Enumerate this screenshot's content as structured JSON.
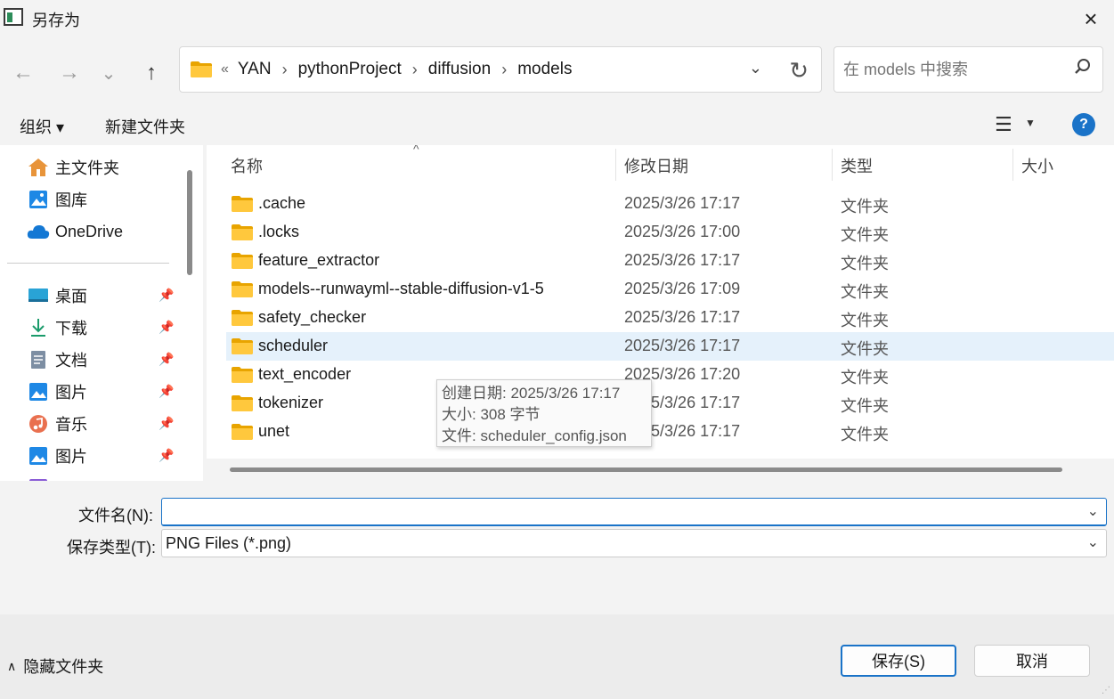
{
  "window": {
    "title": "另存为",
    "close_icon": "×"
  },
  "nav": {
    "back_icon": "←",
    "forward_icon": "→",
    "recent_icon": "⌄",
    "up_icon": "↑",
    "crumbs_lead": "«",
    "crumbs": [
      "YAN",
      "pythonProject",
      "diffusion",
      "models"
    ],
    "dropdown_icon": "⌄",
    "refresh_icon": "↻",
    "search_placeholder": "在 models 中搜索"
  },
  "toolbar": {
    "organize": "组织 ▾",
    "new_folder": "新建文件夹",
    "help": "?"
  },
  "sidebar": {
    "top": [
      {
        "label": "主文件夹",
        "icon": "home-icon"
      },
      {
        "label": "图库",
        "icon": "gallery-icon"
      },
      {
        "label": "OneDrive",
        "icon": "cloud-icon"
      }
    ],
    "pinned": [
      {
        "label": "桌面",
        "icon": "desktop-icon"
      },
      {
        "label": "下载",
        "icon": "download-icon"
      },
      {
        "label": "文档",
        "icon": "document-icon"
      },
      {
        "label": "图片",
        "icon": "pictures-icon"
      },
      {
        "label": "音乐",
        "icon": "music-icon"
      },
      {
        "label": "图片",
        "icon": "pictures-icon"
      }
    ]
  },
  "columns": {
    "name": "名称",
    "modified": "修改日期",
    "type": "类型",
    "size": "大小"
  },
  "files": [
    {
      "name": ".cache",
      "modified": "2025/3/26 17:17",
      "type": "文件夹"
    },
    {
      "name": ".locks",
      "modified": "2025/3/26 17:00",
      "type": "文件夹"
    },
    {
      "name": "feature_extractor",
      "modified": "2025/3/26 17:17",
      "type": "文件夹"
    },
    {
      "name": "models--runwayml--stable-diffusion-v1-5",
      "modified": "2025/3/26 17:09",
      "type": "文件夹"
    },
    {
      "name": "safety_checker",
      "modified": "2025/3/26 17:17",
      "type": "文件夹"
    },
    {
      "name": "scheduler",
      "modified": "2025/3/26 17:17",
      "type": "文件夹"
    },
    {
      "name": "text_encoder",
      "modified": "2025/3/26 17:20",
      "type": "文件夹"
    },
    {
      "name": "tokenizer",
      "modified": "2025/3/26 17:17",
      "type": "文件夹"
    },
    {
      "name": "unet",
      "modified": "2025/3/26 17:17",
      "type": "文件夹"
    }
  ],
  "tooltip": {
    "created": "创建日期: 2025/3/26 17:17",
    "size": "大小: 308 字节",
    "file": "文件: scheduler_config.json"
  },
  "form": {
    "filename_label": "文件名(N):",
    "filename_value": "",
    "filetype_label": "保存类型(T):",
    "filetype_value": "PNG Files (*.png)"
  },
  "footer": {
    "hide_folders": "隐藏文件夹",
    "save": "保存(S)",
    "cancel": "取消"
  }
}
